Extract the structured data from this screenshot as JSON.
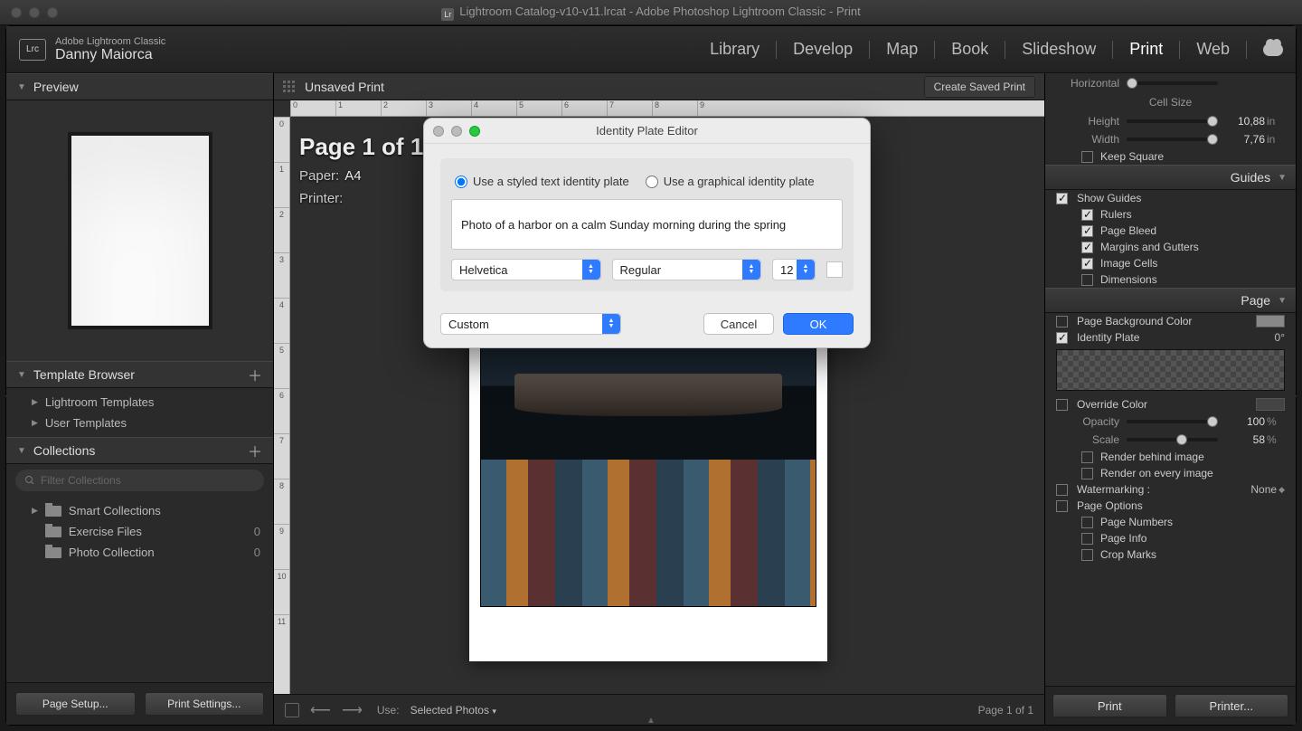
{
  "titlebar": {
    "title": "Lightroom Catalog-v10-v11.lrcat - Adobe Photoshop Lightroom Classic - Print"
  },
  "brand": {
    "logo": "Lrc",
    "line1": "Adobe Lightroom Classic",
    "line2": "Danny Maiorca"
  },
  "modules": {
    "library": "Library",
    "develop": "Develop",
    "map": "Map",
    "book": "Book",
    "slideshow": "Slideshow",
    "print": "Print",
    "web": "Web"
  },
  "left": {
    "preview_head": "Preview",
    "template_head": "Template Browser",
    "template_items": [
      "Lightroom Templates",
      "User Templates"
    ],
    "collections_head": "Collections",
    "filter_placeholder": "Filter Collections",
    "collections": [
      {
        "name": "Smart Collections",
        "count": ""
      },
      {
        "name": "Exercise Files",
        "count": "0"
      },
      {
        "name": "Photo Collection",
        "count": "0"
      }
    ],
    "page_setup": "Page Setup...",
    "print_settings": "Print Settings..."
  },
  "center": {
    "top_label": "Unsaved Print",
    "saved_btn": "Create Saved Print",
    "page_label": "Page 1 of 1",
    "paper_label": "Paper:",
    "paper_value": "A4",
    "printer_label": "Printer:",
    "ruler_h": [
      "0",
      "1",
      "2",
      "3",
      "4",
      "5",
      "6",
      "7",
      "8",
      "9"
    ],
    "ruler_v": [
      "0",
      "1",
      "2",
      "3",
      "4",
      "5",
      "6",
      "7",
      "8",
      "9",
      "10",
      "11"
    ],
    "bottom_use": "Use:",
    "bottom_selected": "Selected Photos",
    "bottom_page": "Page 1 of 1"
  },
  "right": {
    "cell_size": "Cell Size",
    "height_label": "Height",
    "height_val": "10,88",
    "height_unit": "in",
    "width_label": "Width",
    "width_val": "7,76",
    "width_unit": "in",
    "keep_square": "Keep Square",
    "guides_head": "Guides",
    "show_guides": "Show Guides",
    "rulers": "Rulers",
    "page_bleed": "Page Bleed",
    "margins": "Margins and Gutters",
    "image_cells": "Image Cells",
    "dimensions": "Dimensions",
    "page_head": "Page",
    "page_bg": "Page Background Color",
    "identity": "Identity Plate",
    "identity_deg": "0°",
    "override": "Override Color",
    "opacity": "Opacity",
    "opacity_val": "100",
    "opacity_unit": "%",
    "scale": "Scale",
    "scale_val": "58",
    "scale_unit": "%",
    "render_behind": "Render behind image",
    "render_every": "Render on every image",
    "watermark": "Watermarking :",
    "watermark_val": "None",
    "page_options": "Page Options",
    "page_numbers": "Page Numbers",
    "page_info": "Page Info",
    "crop_marks": "Crop Marks",
    "horizontal": "Horizontal",
    "print_btn": "Print",
    "printer_btn": "Printer..."
  },
  "dialog": {
    "title": "Identity Plate Editor",
    "radio_text": "Use a styled text identity plate",
    "radio_graphic": "Use a graphical identity plate",
    "text_value": "Photo of a harbor on a calm Sunday morning during the spring",
    "font": "Helvetica",
    "weight": "Regular",
    "size": "12",
    "preset": "Custom",
    "cancel": "Cancel",
    "ok": "OK"
  }
}
